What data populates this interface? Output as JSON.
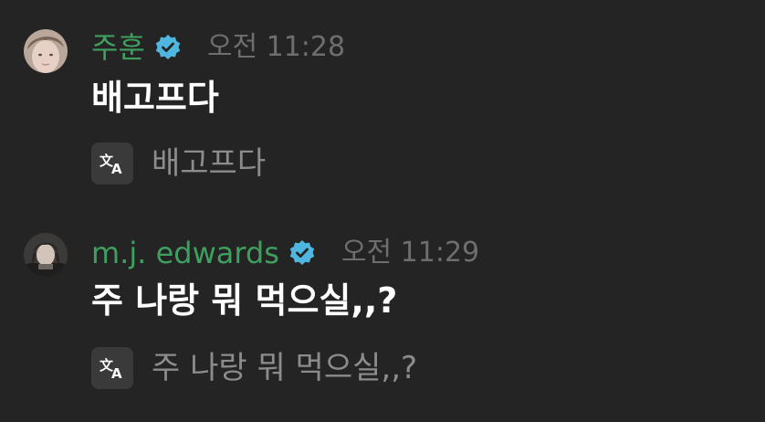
{
  "messages": [
    {
      "username": "주훈",
      "time": "오전 11:28",
      "text": "배고프다",
      "translation": "배고프다",
      "avatar_icon": "user-avatar-photo"
    },
    {
      "username": "m.j. edwards",
      "time": "오전 11:29",
      "text": "주 나랑 뭐 먹으실,,?",
      "translation": "주 나랑 뭐 먹으실,,?",
      "avatar_icon": "user-avatar-photo"
    }
  ],
  "colors": {
    "background": "#242424",
    "username": "#3ea05e",
    "verified": "#4fb6e0",
    "timestamp": "#6e6e6e",
    "message_text": "#ffffff",
    "translation_text": "#8c8c8c"
  },
  "icons": {
    "verified": "verified-badge-icon",
    "translate": "translate-icon"
  }
}
